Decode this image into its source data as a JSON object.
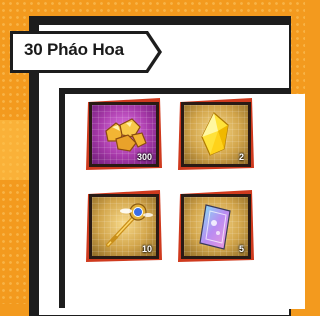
{
  "banner": {
    "title": "30 Pháo Hoa"
  },
  "items": [
    {
      "name": "gold-nuggets",
      "quantity": "300",
      "tile_color": "#a83aaa",
      "icon": "gold-nuggets-icon"
    },
    {
      "name": "yellow-crystal",
      "quantity": "2",
      "tile_color": "#d2a54b",
      "icon": "yellow-crystal-icon"
    },
    {
      "name": "golden-key",
      "quantity": "10",
      "tile_color": "#d2a54b",
      "icon": "golden-key-icon"
    },
    {
      "name": "ticket-card",
      "quantity": "5",
      "tile_color": "#d2a54b",
      "icon": "ticket-card-icon"
    }
  ],
  "colors": {
    "background": "#f39a1e",
    "frame": "#cf3a1e",
    "panel": "#ffffff",
    "outline": "#1d1d1d"
  }
}
